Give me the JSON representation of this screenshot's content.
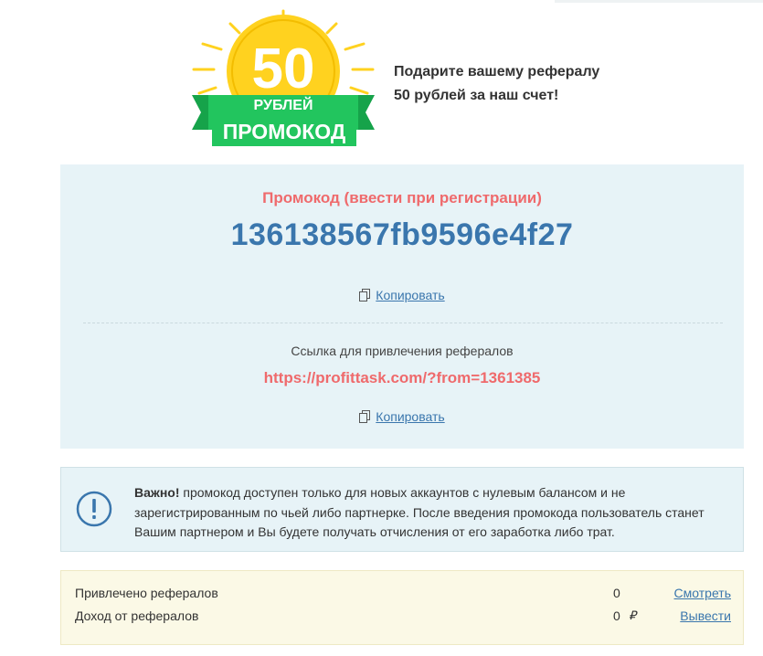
{
  "badge": {
    "amount": "50",
    "currency": "РУБЛЕЙ",
    "ribbon": "ПРОМОКОД",
    "coin_color": "#ffd21f",
    "ribbon_color": "#22c55e"
  },
  "promo_text": {
    "line1": "Подарите вашему рефералу",
    "line2": "50 рублей за наш счет!"
  },
  "promo": {
    "label": "Промокод (ввести при регистрации)",
    "code": "136138567fb9596e4f27",
    "copy_label": "Копировать",
    "ref_label": "Ссылка для привлечения рефералов",
    "ref_link": "https://profittask.com/?from=1361385",
    "copy_label2": "Копировать"
  },
  "notice": {
    "strong": "Важно!",
    "text": " промокод доступен только для новых аккаунтов с нулевым балансом и не зарегистрированным по чьей либо партнерке. После введения промокода пользователь станет Вашим партнером и Вы будете получать отчисления от его заработка либо трат."
  },
  "stats": {
    "referrals_label": "Привлечено рефералов",
    "referrals_value": "0",
    "referrals_action": "Смотреть",
    "income_label": "Доход от рефералов",
    "income_value": "0",
    "income_currency": "₽",
    "income_action": "Вывести"
  },
  "colors": {
    "accent_blue": "#3a76ad",
    "accent_red": "#ef6a6c",
    "panel_bg": "#e7f3f7",
    "stats_bg": "#fbf9e6"
  }
}
